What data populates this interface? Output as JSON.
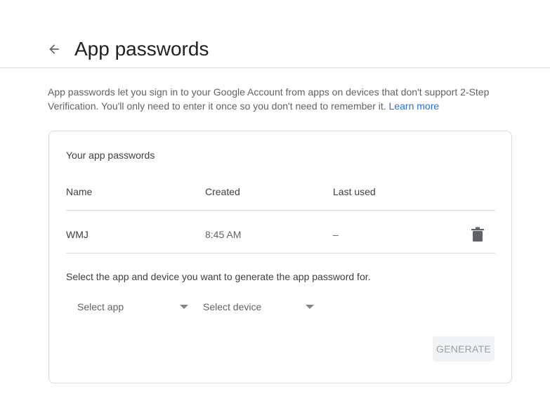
{
  "header": {
    "back_icon": "arrow-left-icon",
    "title": "App passwords"
  },
  "intro": {
    "text": "App passwords let you sign in to your Google Account from apps on devices that don't support 2-Step Verification. You'll only need to enter it once so you don't need to remember it. ",
    "link_label": "Learn more"
  },
  "card": {
    "title": "Your app passwords",
    "columns": [
      "Name",
      "Created",
      "Last used"
    ],
    "rows": [
      {
        "name": "WMJ",
        "created": "8:45 AM",
        "last_used": "–",
        "delete_icon": "trash-icon"
      }
    ],
    "select_prompt": "Select the app and device you want to generate the app password for.",
    "select_app_label": "Select app",
    "select_device_label": "Select device",
    "generate_label": "GENERATE"
  },
  "colors": {
    "link": "#1a73e8",
    "border": "#dadce0",
    "muted_text": "#5f6368",
    "button_disabled_bg": "#f1f3f4"
  }
}
